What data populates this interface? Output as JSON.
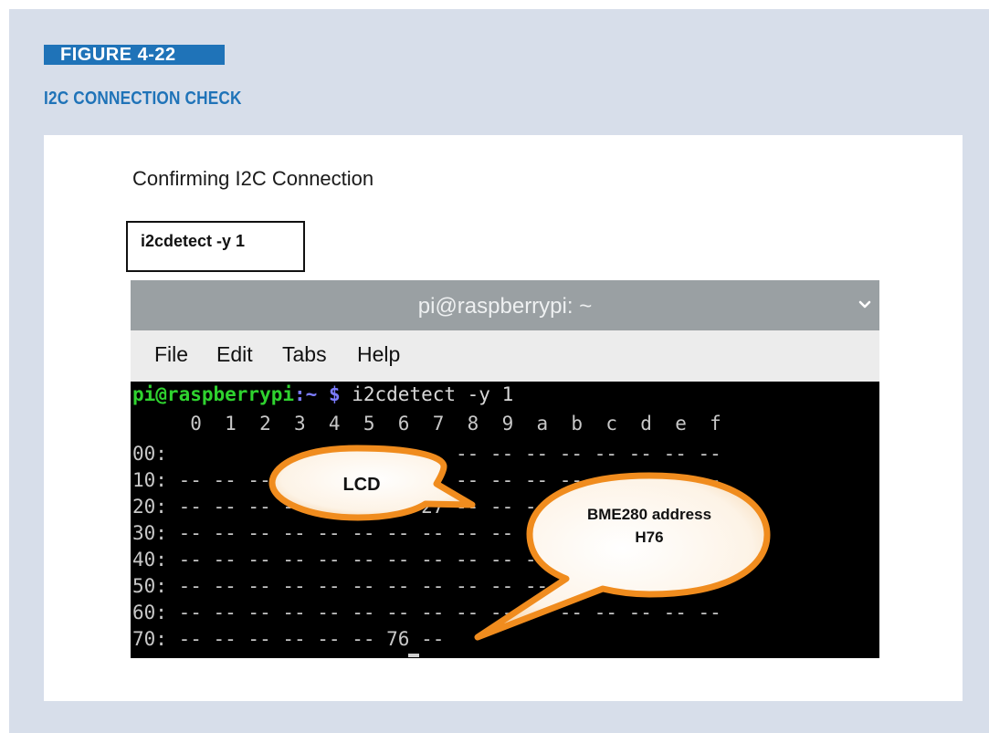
{
  "figure": {
    "number_label": "FIGURE 4-22",
    "title": "I2C CONNECTION CHECK"
  },
  "card": {
    "heading": "Confirming I2C Connection",
    "command_box": "i2cdetect -y 1"
  },
  "terminal": {
    "window_title": "pi@raspberrypi: ~",
    "menu": [
      "File",
      "Edit",
      "Tabs",
      "Help"
    ],
    "prompt_user": "pi@raspberrypi",
    "prompt_path": ":~ $",
    "command": " i2cdetect -y 1",
    "header_row": "     0  1  2  3  4  5  6  7  8  9  a  b  c  d  e  f",
    "rows": [
      "00:                         -- -- -- -- -- -- -- --",
      "10: -- -- -- -- -- -- -- -- -- -- -- -- -- -- -- --",
      "20: -- -- -- -- -- -- -- 27 -- -- -- -- -- -- -- --",
      "30: -- -- -- -- -- -- -- -- -- -- -- -- -- -- -- --",
      "40: -- -- -- -- -- -- -- -- -- -- -- -- -- -- -- --",
      "50: -- -- -- -- -- -- -- -- -- -- -- -- -- -- -- --",
      "60: -- -- -- -- -- -- -- -- -- -- -- -- -- -- -- --",
      "70: -- -- -- -- -- -- 76 --"
    ]
  },
  "callouts": {
    "lcd": "LCD",
    "bme_line1": "BME280 address",
    "bme_line2": "H76"
  },
  "colors": {
    "accent_blue": "#1f73b8",
    "panel_bg": "#d7deea",
    "bubble_border": "#f08c1e",
    "prompt_green": "#2fd32f",
    "prompt_blue": "#7c7cff"
  }
}
